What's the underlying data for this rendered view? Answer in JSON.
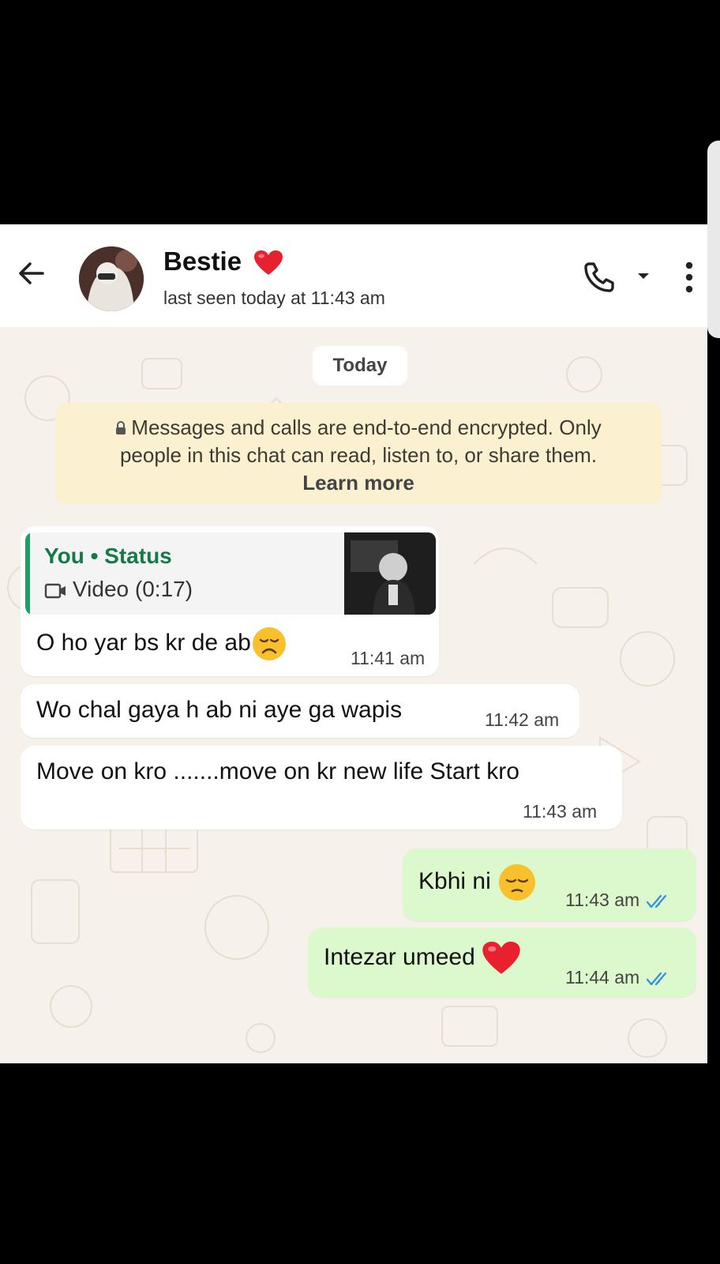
{
  "contact": {
    "name": "Bestie",
    "last_seen": "last seen today at 11:43 am"
  },
  "chat": {
    "date_divider": "Today",
    "encryption_notice": {
      "line1": "Messages and calls are end-to-end encrypted. Only",
      "line2": "people in this chat can read, listen to, or share them.",
      "link": "Learn more"
    },
    "messages": [
      {
        "direction": "incoming",
        "reply": {
          "title": "You • Status",
          "subtitle": "Video (0:17)"
        },
        "text": "O ho yar bs kr de ab",
        "emoji": "disappointed-face",
        "time": "11:41 am"
      },
      {
        "direction": "incoming",
        "text": "Wo chal gaya h ab ni aye ga wapis",
        "time": "11:42 am"
      },
      {
        "direction": "incoming",
        "text": "Move on kro .......move on kr new life Start kro",
        "time": "11:43 am"
      },
      {
        "direction": "outgoing",
        "text": "Kbhi ni",
        "emoji": "pensive-face",
        "time": "11:43 am",
        "status": "read"
      },
      {
        "direction": "outgoing",
        "text": "Intezar umeed",
        "emoji": "red-heart",
        "time": "11:44 am",
        "status": "read"
      }
    ]
  },
  "colors": {
    "incoming_bubble": "#ffffff",
    "outgoing_bubble": "#dcf8cd",
    "chat_background": "#f6f1ea",
    "encryption_banner": "#fbf1d1",
    "reply_accent": "#1d9e63",
    "read_tick": "#2f8fe0"
  },
  "icons": [
    "back-arrow-icon",
    "phone-icon",
    "dropdown-icon",
    "more-vert-icon",
    "lock-icon",
    "video-icon",
    "double-tick-icon"
  ]
}
